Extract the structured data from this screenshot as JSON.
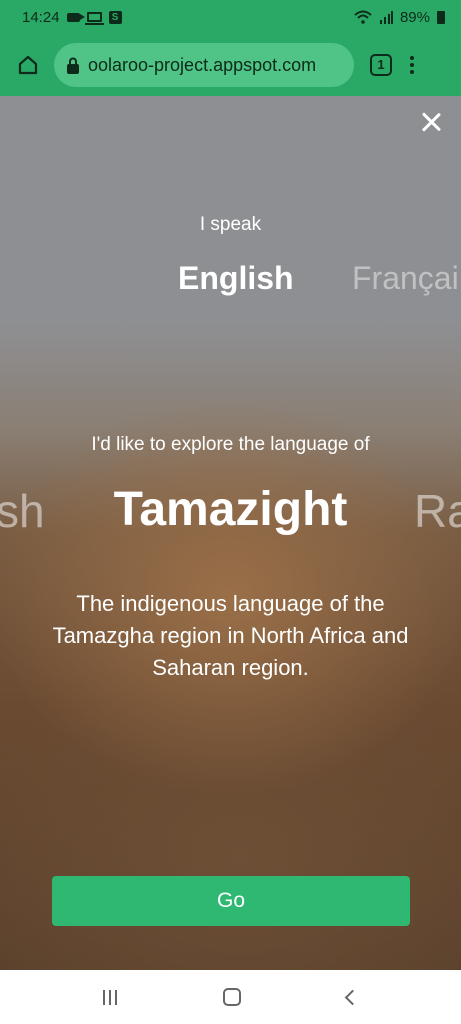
{
  "status_bar": {
    "time": "14:24",
    "battery": "89%"
  },
  "browser": {
    "url": "oolaroo-project.appspot.com",
    "tab_count": "1"
  },
  "speak": {
    "label": "I speak",
    "selected": "English",
    "next": "Françai"
  },
  "explore": {
    "label": "I'd like to explore the language of",
    "prev": "sh",
    "selected": "Tamazight",
    "next": "Ra",
    "description": "The indigenous language of the Tamazgha region in North Africa and Saharan region."
  },
  "go_button": {
    "label": "Go"
  },
  "colors": {
    "brand_green": "#2aa866",
    "button_green": "#2eb872"
  }
}
